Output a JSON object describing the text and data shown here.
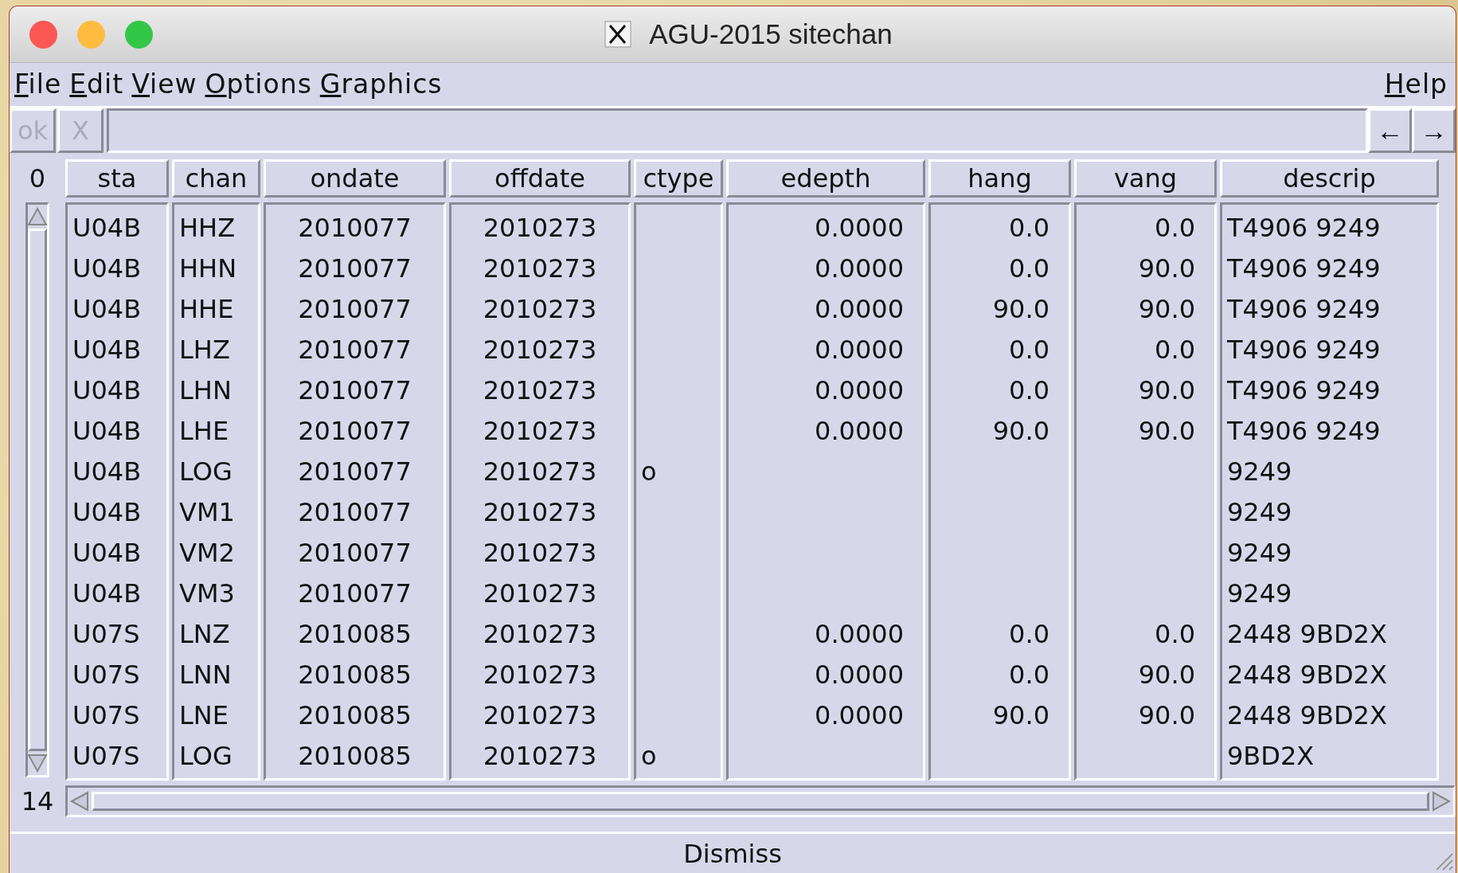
{
  "window": {
    "title": "AGU-2015 sitechan"
  },
  "menu": {
    "items": [
      {
        "label": "File"
      },
      {
        "label": "Edit"
      },
      {
        "label": "View"
      },
      {
        "label": "Options"
      },
      {
        "label": "Graphics"
      }
    ],
    "help": "Help"
  },
  "toolbar": {
    "ok": {
      "label": "ok",
      "disabled": true
    },
    "cancel": {
      "label": "X",
      "disabled": true
    },
    "prev": "←",
    "next": "→"
  },
  "table": {
    "first_row_index": "0",
    "last_row_index": "14",
    "columns": [
      "sta",
      "chan",
      "ondate",
      "offdate",
      "ctype",
      "edepth",
      "hang",
      "vang",
      "descrip"
    ],
    "rows": [
      {
        "cells": [
          "U04B",
          "HHZ",
          "2010077",
          "2010273",
          null,
          "0.0000",
          "0.0",
          "0.0",
          "T4906 9249"
        ]
      },
      {
        "cells": [
          "U04B",
          "HHN",
          "2010077",
          "2010273",
          null,
          "0.0000",
          "0.0",
          "90.0",
          "T4906 9249"
        ]
      },
      {
        "cells": [
          "U04B",
          "HHE",
          "2010077",
          "2010273",
          null,
          "0.0000",
          "90.0",
          "90.0",
          "T4906 9249"
        ]
      },
      {
        "cells": [
          "U04B",
          "LHZ",
          "2010077",
          "2010273",
          null,
          "0.0000",
          "0.0",
          "0.0",
          "T4906 9249"
        ]
      },
      {
        "cells": [
          "U04B",
          "LHN",
          "2010077",
          "2010273",
          null,
          "0.0000",
          "0.0",
          "90.0",
          "T4906 9249"
        ]
      },
      {
        "cells": [
          "U04B",
          "LHE",
          "2010077",
          "2010273",
          null,
          "0.0000",
          "90.0",
          "90.0",
          "T4906 9249"
        ]
      },
      {
        "cells": [
          "U04B",
          "LOG",
          "2010077",
          "2010273",
          "o",
          null,
          null,
          null,
          "9249"
        ]
      },
      {
        "cells": [
          "U04B",
          "VM1",
          "2010077",
          "2010273",
          null,
          null,
          null,
          null,
          "9249"
        ]
      },
      {
        "cells": [
          "U04B",
          "VM2",
          "2010077",
          "2010273",
          null,
          null,
          null,
          null,
          "9249"
        ]
      },
      {
        "cells": [
          "U04B",
          "VM3",
          "2010077",
          "2010273",
          null,
          null,
          null,
          null,
          "9249"
        ]
      },
      {
        "cells": [
          "U07S",
          "LNZ",
          "2010085",
          "2010273",
          null,
          "0.0000",
          "0.0",
          "0.0",
          "2448 9BD2X"
        ]
      },
      {
        "cells": [
          "U07S",
          "LNN",
          "2010085",
          "2010273",
          null,
          "0.0000",
          "0.0",
          "90.0",
          "2448 9BD2X"
        ]
      },
      {
        "cells": [
          "U07S",
          "LNE",
          "2010085",
          "2010273",
          null,
          "0.0000",
          "90.0",
          "90.0",
          "2448 9BD2X"
        ]
      },
      {
        "cells": [
          "U07S",
          "LOG",
          "2010085",
          "2010273",
          "o",
          null,
          null,
          null,
          "9BD2X"
        ]
      }
    ]
  },
  "dismiss": "Dismiss"
}
